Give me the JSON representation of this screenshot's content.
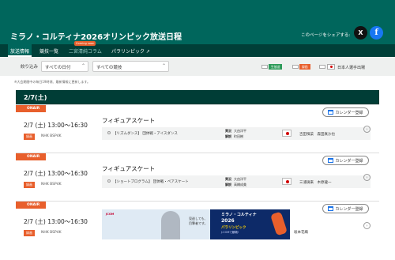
{
  "header": {
    "title": "ミラノ・コルティナ2026オリンピック放送日程",
    "share_text": "このページをシェアする:",
    "social_x": "X",
    "social_fb": "f"
  },
  "nav": {
    "items": [
      "放送情報",
      "競技一覧",
      "二宮清純コラム",
      "パラリンピック ↗"
    ],
    "badge": "Coming soon"
  },
  "filters": {
    "label": "絞り込み",
    "date_select": "すべての日付",
    "sport_select": "すべての競技",
    "caret": "⌃",
    "legend_live": "生放送",
    "legend_rec": "録画",
    "legend_japan": "日本人選手出場",
    "colors": {
      "live": "#2e9b5a",
      "rec": "#e85f2c"
    }
  },
  "note": "※大会期間中の毎日19時頃、最新情報に更新します。",
  "date_header": "2/7(土)",
  "programs": [
    {
      "on_air": "ONAIR",
      "time": "2/7 (土) 13:00～16:30",
      "badge": "録画",
      "channel": "NHK BSP4K",
      "title": "フィギュアスケート",
      "detail": "【リズムダンス】 団体戦・アイスダンス",
      "staff_label1": "実況",
      "staff_name1": "大由洋平",
      "staff_label2": "解説",
      "staff_name2": "町田樹",
      "athletes": "吉田唄菜　森田真沙也",
      "calendar": "カレンダー登録",
      "expand": "›"
    },
    {
      "on_air": "ONAIR",
      "time": "2/7 (土) 13:00～16:30",
      "badge": "録画",
      "channel": "NHK BSP4K",
      "title": "フィギュアスケート",
      "detail": "【ショートプログラム】 団体戦・ペアスケート",
      "staff_label1": "実況",
      "staff_name1": "大由洋平",
      "staff_label2": "解説",
      "staff_name2": "高橋成美",
      "athletes": "三浦璃来　木原龍一",
      "calendar": "カレンダー登録",
      "expand": "›"
    },
    {
      "on_air": "ONAIR",
      "time": "2/7 (土) 13:00～16:30",
      "badge": "録画",
      "channel": "NHK BSP4K",
      "calendar": "カレンダー登録",
      "expand": "›",
      "staff_right": "坂本花織"
    }
  ],
  "banner": {
    "logo": "JCOM",
    "copy1": "見逃しても、",
    "copy2": "目撃者です。",
    "right_t1": "ミラノ・コルティナ",
    "right_t2": "2026",
    "right_t3": "パラリンピック",
    "right_t4": "J:COMで観戦!"
  }
}
